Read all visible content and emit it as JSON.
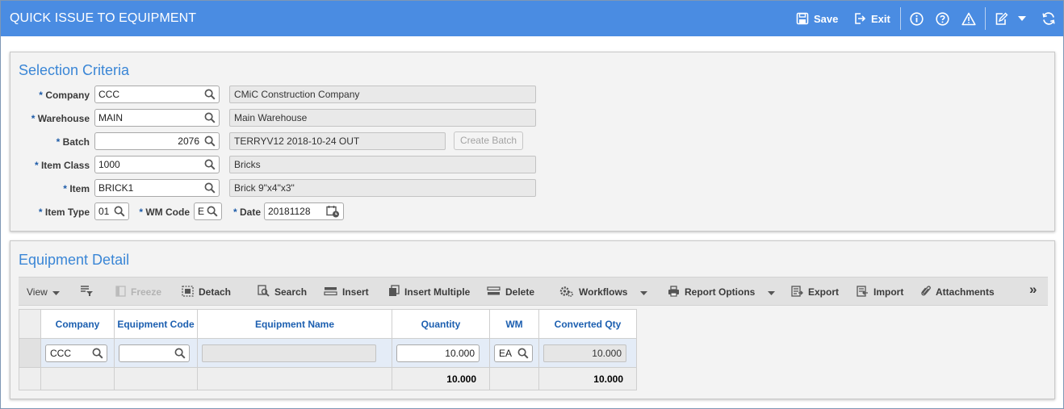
{
  "window": {
    "title": "QUICK ISSUE TO EQUIPMENT"
  },
  "header_actions": {
    "save": "Save",
    "exit": "Exit"
  },
  "header_icons": [
    "info-icon",
    "help-icon",
    "warning-icon",
    "edit-icon",
    "chevron-down-icon",
    "refresh-icon"
  ],
  "selection": {
    "title": "Selection Criteria",
    "company": {
      "label": "Company",
      "value": "CCC",
      "desc": "CMiC Construction Company"
    },
    "warehouse": {
      "label": "Warehouse",
      "value": "MAIN",
      "desc": "Main Warehouse"
    },
    "batch": {
      "label": "Batch",
      "value": "2076",
      "desc": "TERRYV12 2018-10-24 OUT",
      "button": "Create Batch"
    },
    "item_class": {
      "label": "Item Class",
      "value": "1000",
      "desc": "Bricks"
    },
    "item": {
      "label": "Item",
      "value": "BRICK1",
      "desc": "Brick 9\"x4\"x3\""
    },
    "item_type": {
      "label": "Item Type",
      "value": "01"
    },
    "wm_code": {
      "label": "WM Code",
      "value": "E"
    },
    "date": {
      "label": "Date",
      "value": "20181128"
    },
    "required_mark": "*"
  },
  "equipment": {
    "title": "Equipment Detail",
    "toolbar": {
      "view": "View",
      "freeze": "Freeze",
      "detach": "Detach",
      "search": "Search",
      "insert": "Insert",
      "insert_multiple": "Insert Multiple",
      "delete": "Delete",
      "workflows": "Workflows",
      "report_options": "Report Options",
      "export": "Export",
      "import": "Import",
      "attachments": "Attachments",
      "more": "»"
    },
    "columns": [
      "Company",
      "Equipment Code",
      "Equipment Name",
      "Quantity",
      "WM",
      "Converted Qty"
    ],
    "rows": [
      {
        "company": "CCC",
        "equipment_code": "",
        "equipment_name": "",
        "quantity": "10.000",
        "wm": "EA",
        "converted_qty": "10.000"
      }
    ],
    "totals": {
      "quantity": "10.000",
      "converted_qty": "10.000"
    }
  },
  "colors": {
    "header_bg": "#4a8ce2",
    "section_title": "#3a86d6",
    "column_header": "#1c5fb0"
  }
}
